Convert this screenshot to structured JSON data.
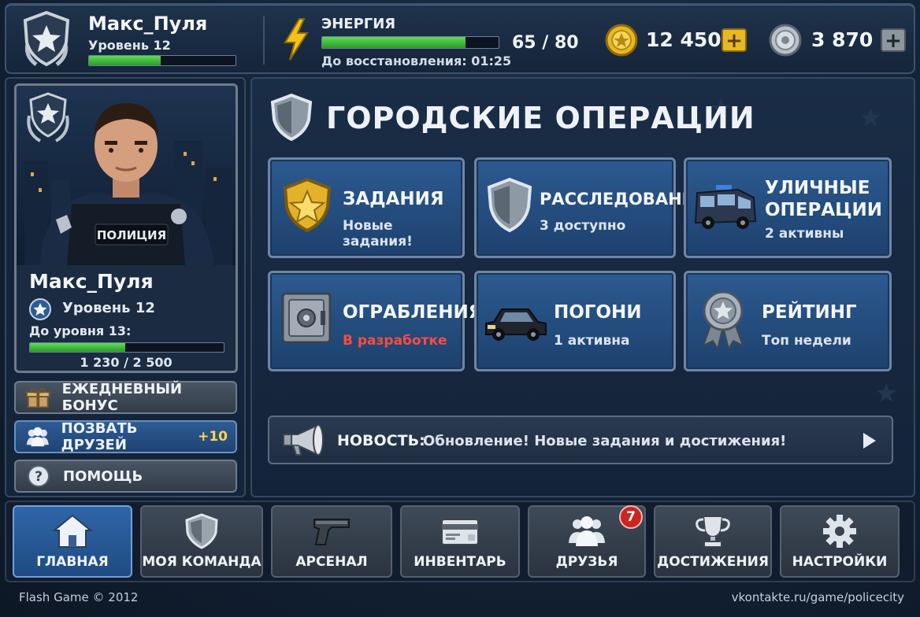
{
  "colors": {
    "accent_blue": "#2c5a90",
    "xp_green": "#4ccc44",
    "gold": "#e8b923",
    "warning_red": "#ff4b3b",
    "badge_red": "#c8261f"
  },
  "header": {
    "player_name": "Макс_Пуля",
    "level_text": "Уровень 12",
    "level_progress_fraction": 0.49,
    "energy": {
      "label": "ЭНЕРГИЯ",
      "current": 65,
      "max": 80,
      "value_text": "65 / 80",
      "restore_text": "До восстановления: 01:25",
      "icon": "lightning-icon"
    },
    "gold": {
      "value_text": "12 450",
      "icon": "gold-coin-icon"
    },
    "silver": {
      "value_text": "3 870",
      "icon": "silver-coin-icon"
    }
  },
  "profile": {
    "name": "Макс_Пуля",
    "level_text": "Уровень 12",
    "next_level_text": "До уровня 13:",
    "xp_current": 1230,
    "xp_needed": 2500,
    "xp_text": "1 230 / 2 500",
    "vest_text": "ПОЛИЦИЯ"
  },
  "sidebar": {
    "buttons": [
      {
        "label": "ЕЖЕДНЕВНЫЙ БОНУС",
        "icon": "gift-icon"
      },
      {
        "label": "ПОЗВАТЬ ДРУЗЕЙ",
        "icon": "people-icon",
        "extra": "+10"
      },
      {
        "label": "ПОМОЩЬ",
        "icon": "help-icon"
      }
    ]
  },
  "main": {
    "title": "ГОРОДСКИЕ ОПЕРАЦИИ",
    "tiles": [
      {
        "title": "ЗАДАНИЯ",
        "subtitle": "Новые задания!",
        "icon": "gold-badge-icon"
      },
      {
        "title": "РАССЛЕДОВАНИЯ",
        "subtitle": "3 доступно",
        "icon": "shield-icon"
      },
      {
        "title": "УЛИЧНЫЕ ОПЕРАЦИИ",
        "title_line1": "УЛИЧНЫЕ",
        "title_line2": "ОПЕРАЦИИ",
        "subtitle": "2 активны",
        "icon": "police-van-icon"
      },
      {
        "title": "ОГРАБЛЕНИЯ",
        "subtitle": "В разработке",
        "subtitle_status": "warning",
        "icon": "safe-icon"
      },
      {
        "title": "ПОГОНИ",
        "subtitle": "1 активна",
        "icon": "car-icon"
      },
      {
        "title": "РЕЙТИНГ",
        "subtitle": "Топ недели",
        "icon": "medal-icon"
      }
    ],
    "news": {
      "label": "НОВОСТЬ:",
      "text": "Обновление! Новые задания и достижения!",
      "icon": "megaphone-icon"
    }
  },
  "bottom_nav": [
    {
      "label": "ГЛАВНАЯ",
      "icon": "home-icon",
      "active": true
    },
    {
      "label": "МОЯ КОМАНДА",
      "icon": "shield-icon"
    },
    {
      "label": "АРСЕНАЛ",
      "icon": "pistol-icon"
    },
    {
      "label": "ИНВЕНТАРЬ",
      "icon": "card-icon"
    },
    {
      "label": "ДРУЗЬЯ",
      "icon": "friends-icon",
      "badge": "7"
    },
    {
      "label": "ДОСТИЖЕНИЯ",
      "icon": "trophy-icon"
    },
    {
      "label": "НАСТРОЙКИ",
      "icon": "gear-icon"
    }
  ],
  "footer": {
    "left": "Flash Game © 2012",
    "right": "vkontakte.ru/game/policecity"
  }
}
